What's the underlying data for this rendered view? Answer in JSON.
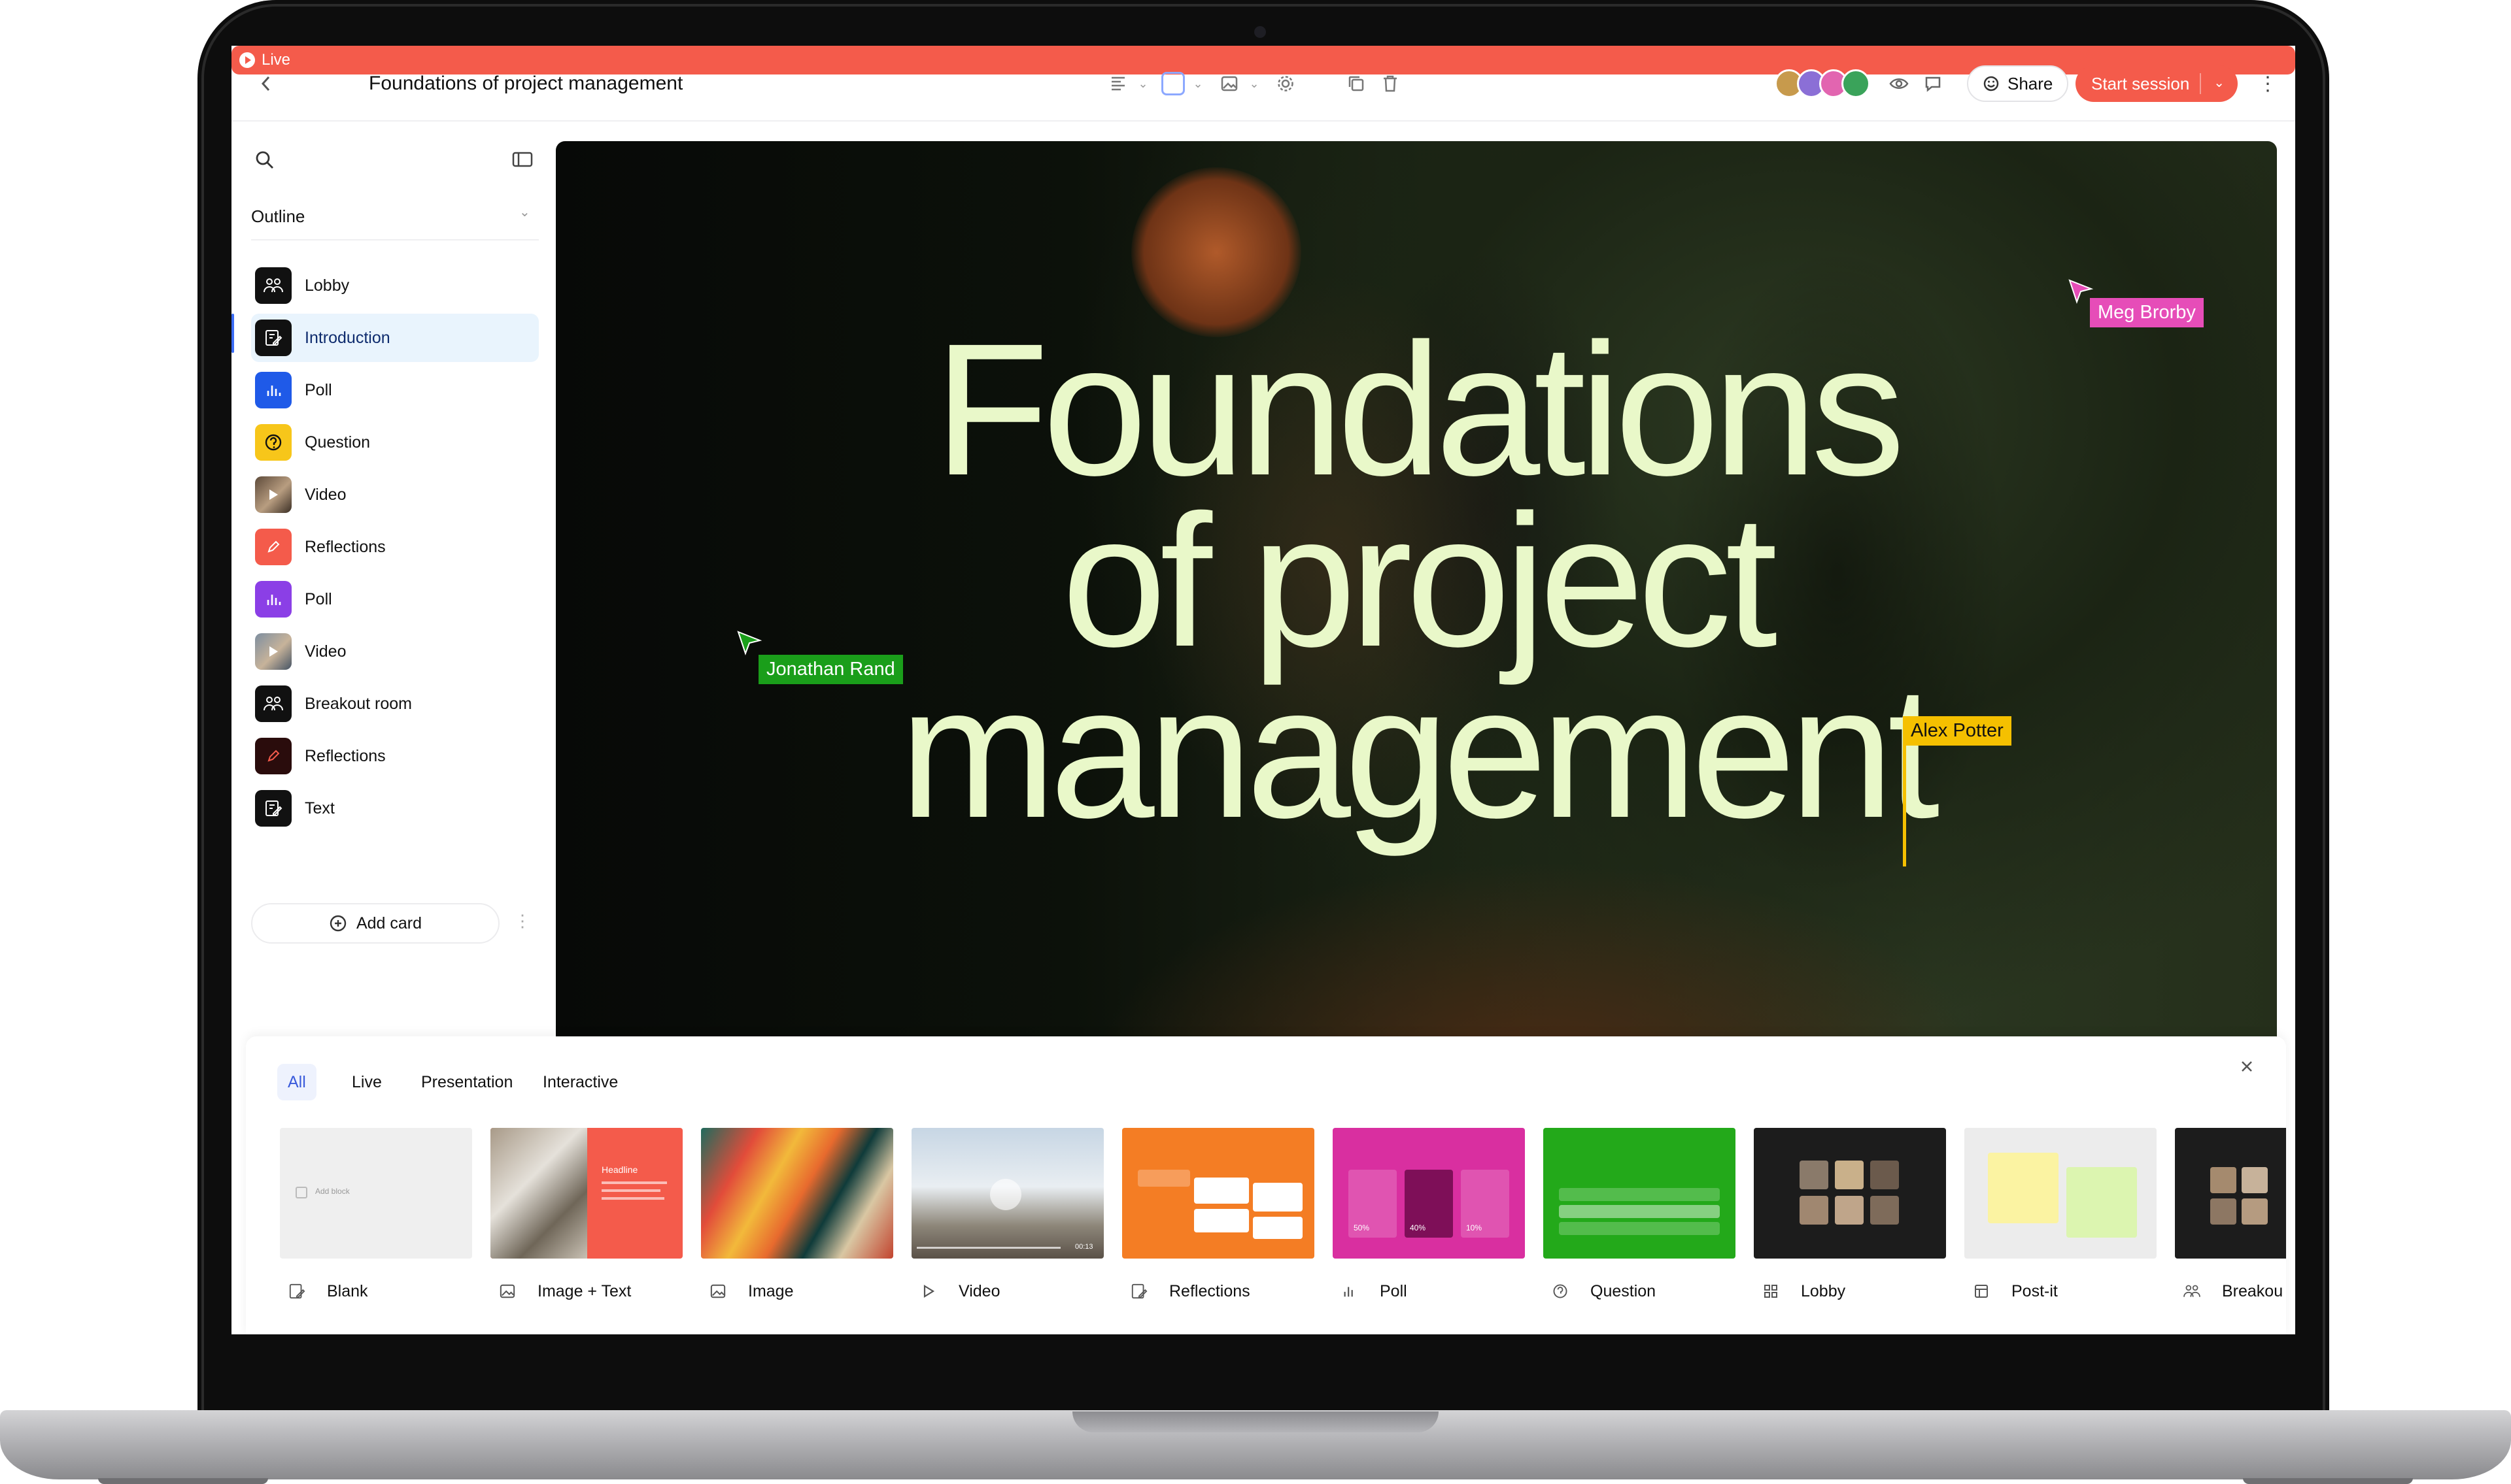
{
  "topbar": {
    "live_label": "Live",
    "title": "Foundations of project management",
    "share_label": "Share",
    "start_label": "Start session"
  },
  "sidebar": {
    "outline_label": "Outline",
    "items": [
      {
        "label": "Lobby",
        "icon": "people-icon"
      },
      {
        "label": "Introduction",
        "icon": "edit-icon"
      },
      {
        "label": "Poll",
        "icon": "bar-chart-icon"
      },
      {
        "label": "Question",
        "icon": "question-icon"
      },
      {
        "label": "Video",
        "icon": "video-thumbnail"
      },
      {
        "label": "Reflections",
        "icon": "pencil-icon"
      },
      {
        "label": "Poll",
        "icon": "bar-chart-icon"
      },
      {
        "label": "Video",
        "icon": "video-thumbnail"
      },
      {
        "label": "Breakout room",
        "icon": "people-icon"
      },
      {
        "label": "Reflections",
        "icon": "pencil-icon"
      },
      {
        "label": "Text",
        "icon": "edit-icon"
      }
    ],
    "add_card_label": "Add card"
  },
  "slide": {
    "headline_line1": "Foundations",
    "headline_line2": "of project",
    "headline_line3": "management",
    "cursors": [
      {
        "name": "Meg Brorby",
        "color": "#e64db8"
      },
      {
        "name": "Jonathan Rand",
        "color": "#1a9e1a"
      },
      {
        "name": "Alex Potter",
        "color": "#f5c000"
      }
    ]
  },
  "templates": {
    "tabs": [
      "All",
      "Live",
      "Presentation",
      "Interactive"
    ],
    "active_tab": "All",
    "cards": [
      {
        "label": "Blank",
        "thumb_text": "Add block"
      },
      {
        "label": "Image + Text",
        "thumb_text": "Headline"
      },
      {
        "label": "Image"
      },
      {
        "label": "Video",
        "thumb_text": "00:13"
      },
      {
        "label": "Reflections"
      },
      {
        "label": "Poll",
        "thumb_values": [
          "50%",
          "40%",
          "10%"
        ]
      },
      {
        "label": "Question"
      },
      {
        "label": "Lobby"
      },
      {
        "label": "Post-it"
      },
      {
        "label": "Breakou"
      }
    ]
  },
  "colors": {
    "accent": "#f45b4b",
    "headline": "#e9f8c9",
    "active_nav_bg": "#e9f4fd"
  }
}
